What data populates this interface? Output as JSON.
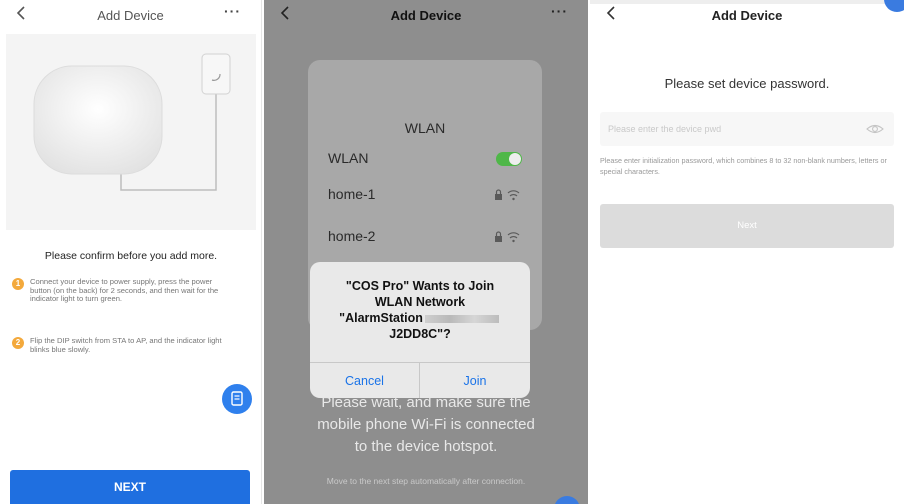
{
  "screen1": {
    "title": "Add Device",
    "more": "···",
    "confirm_heading": "Please confirm before you add more.",
    "steps": [
      {
        "num": "1",
        "text": "Connect your device to power supply, press the power button (on the back) for 2 seconds, and then wait for the indicator light to turn green."
      },
      {
        "num": "2",
        "text": "Flip the DIP switch from STA to AP, and the indicator light blinks blue slowly."
      }
    ],
    "next_label": "NEXT"
  },
  "screen2": {
    "title": "Add Device",
    "more": "···",
    "wlan_title": "WLAN",
    "wlan_toggle_label": "WLAN",
    "networks": [
      "home-1",
      "home-2"
    ],
    "alert": {
      "line1": "\"COS Pro\" Wants to Join",
      "line2": "WLAN Network",
      "line3_prefix": "\"AlarmStation",
      "line4": "J2DD8C\"?",
      "cancel": "Cancel",
      "join": "Join"
    },
    "wait_line1": "Please wait, and make sure the",
    "wait_line2": "mobile phone Wi-Fi is connected",
    "wait_line3": "to the device hotspot.",
    "auto_text": "Move to the next step automatically after connection."
  },
  "screen3": {
    "title": "Add Device",
    "heading": "Please set device password.",
    "password_placeholder": "Please enter the device pwd",
    "password_value": "",
    "hint": "Please enter initialization password, which combines 8 to 32 non-blank numbers, letters or special characters.",
    "next_label": "Next"
  },
  "colors": {
    "primary_blue": "#1f6fe0",
    "step_orange": "#f3a93c",
    "toggle_green": "#4fb748",
    "disabled_gray": "#dcdcdc"
  }
}
